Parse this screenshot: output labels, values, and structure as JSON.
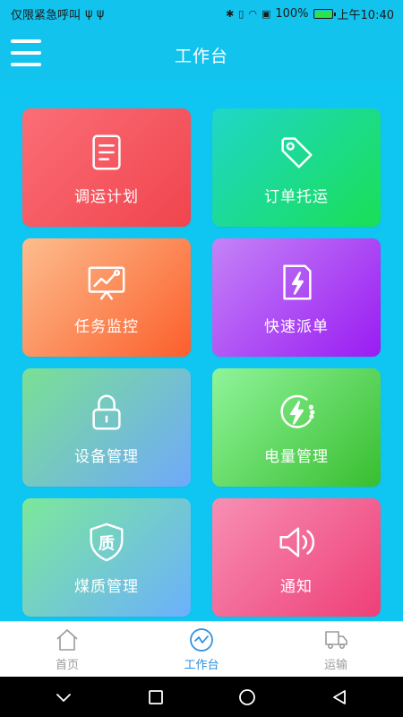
{
  "status_bar": {
    "carrier_text": "仅限紧急呼叫",
    "usb_icons": "ψ ψ",
    "battery_percent": "100%",
    "time": "上午10:40"
  },
  "header": {
    "title": "工作台",
    "menu_icon": "hamburger-menu-icon"
  },
  "tiles": [
    {
      "label": "调运计划",
      "icon": "document-list-icon"
    },
    {
      "label": "订单托运",
      "icon": "tag-icon"
    },
    {
      "label": "任务监控",
      "icon": "monitor-chart-icon"
    },
    {
      "label": "快速派单",
      "icon": "lightning-document-icon"
    },
    {
      "label": "设备管理",
      "icon": "lock-icon"
    },
    {
      "label": "电量管理",
      "icon": "lightning-circle-icon"
    },
    {
      "label": "煤质管理",
      "icon": "quality-shield-icon"
    },
    {
      "label": "通知",
      "icon": "speaker-icon"
    }
  ],
  "quality_glyph": "质",
  "tabbar": {
    "items": [
      {
        "label": "首页",
        "icon": "home-icon",
        "active": false
      },
      {
        "label": "工作台",
        "icon": "pulse-circle-icon",
        "active": true
      },
      {
        "label": "运输",
        "icon": "truck-icon",
        "active": false
      }
    ]
  },
  "colors": {
    "primary": "#12c3ee",
    "active_tab": "#2a8fe0",
    "inactive_tab": "#9b9b9b"
  }
}
